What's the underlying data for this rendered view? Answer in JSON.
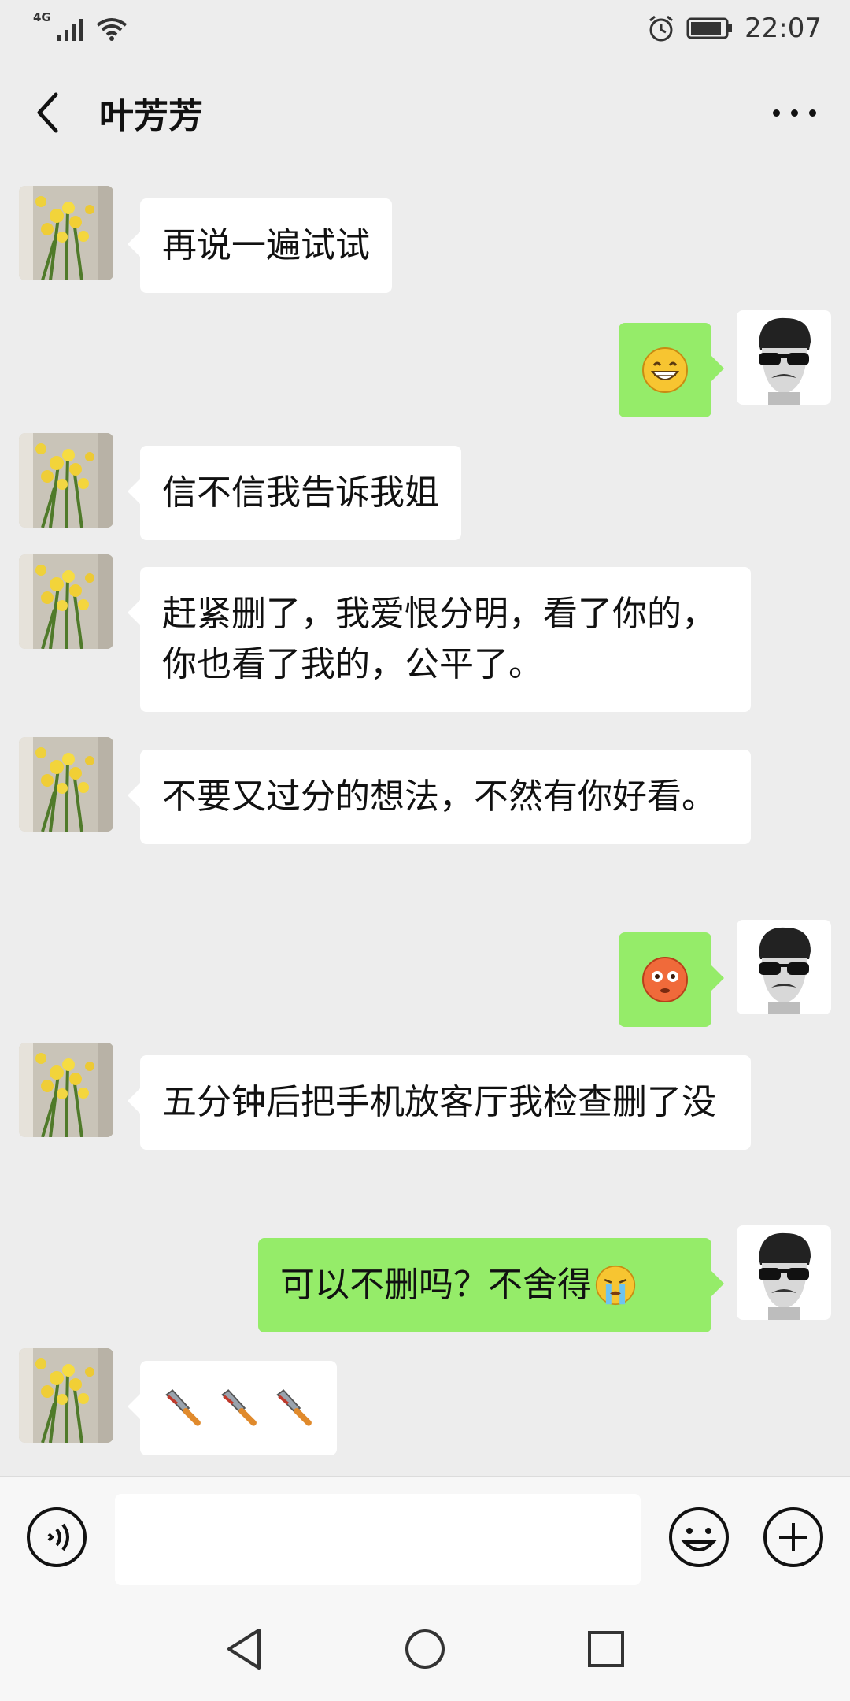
{
  "status_bar": {
    "network": "4G",
    "time": "22:07"
  },
  "header": {
    "title": "叶芳芳"
  },
  "messages": [
    {
      "side": "left",
      "text": "再说一遍试试"
    },
    {
      "side": "right",
      "text": "",
      "emoji": "grinning-face"
    },
    {
      "side": "left",
      "text": "信不信我告诉我姐"
    },
    {
      "side": "left",
      "text": "赶紧删了，我爱恨分明，看了你的，你也看了我的，公平了。"
    },
    {
      "side": "left",
      "text": "不要又过分的想法，不然有你好看。"
    },
    {
      "side": "right",
      "text": "",
      "emoji": "flushed-face"
    },
    {
      "side": "left",
      "text": "五分钟后把手机放客厅我检查删了没"
    },
    {
      "side": "right",
      "text": "可以不删吗？不舍得",
      "emoji": "crying-face"
    },
    {
      "side": "left",
      "text": "",
      "emoji": "kitchen-knife x3"
    }
  ],
  "input_bar": {
    "placeholder": ""
  },
  "colors": {
    "background": "#ededed",
    "bubble_self": "#95ec69",
    "bubble_other": "#ffffff"
  },
  "icons": [
    "signal-icon",
    "wifi-icon",
    "alarm-icon",
    "battery-icon",
    "back-icon",
    "more-icon",
    "voice-icon",
    "emoji-icon",
    "plus-icon",
    "nav-back-icon",
    "nav-home-icon",
    "nav-recent-icon"
  ]
}
